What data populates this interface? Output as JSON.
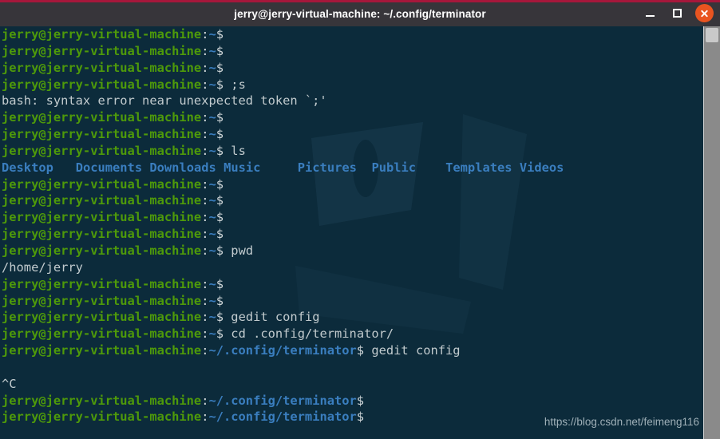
{
  "window": {
    "title": "jerry@jerry-virtual-machine: ~/.config/terminator",
    "controls": {
      "minimize_label": "Minimize",
      "maximize_label": "Maximize",
      "close_label": "Close"
    },
    "accent_color": "#e95420",
    "titlebar_color": "#37353a",
    "stripe_color": "#a6173b"
  },
  "terminal": {
    "background_color": "#0c2b3b",
    "prompt_user_host": "jerry@jerry-virtual-machine",
    "colors": {
      "green": "#4e9a0a",
      "blue": "#3a7ebf",
      "white": "#cfd6d8"
    },
    "lines": [
      {
        "type": "prompt",
        "path": "~",
        "command": ""
      },
      {
        "type": "prompt",
        "path": "~",
        "command": ""
      },
      {
        "type": "prompt",
        "path": "~",
        "command": ""
      },
      {
        "type": "prompt",
        "path": "~",
        "command": " ;s"
      },
      {
        "type": "output",
        "text": "bash: syntax error near unexpected token `;'"
      },
      {
        "type": "prompt",
        "path": "~",
        "command": ""
      },
      {
        "type": "prompt",
        "path": "~",
        "command": ""
      },
      {
        "type": "prompt",
        "path": "~",
        "command": " ls"
      },
      {
        "type": "ls",
        "items": [
          "Desktop",
          "Documents",
          "Downloads",
          "Music",
          "Pictures",
          "Public",
          "Templates",
          "Videos"
        ]
      },
      {
        "type": "prompt",
        "path": "~",
        "command": ""
      },
      {
        "type": "prompt",
        "path": "~",
        "command": ""
      },
      {
        "type": "prompt",
        "path": "~",
        "command": ""
      },
      {
        "type": "prompt",
        "path": "~",
        "command": ""
      },
      {
        "type": "prompt",
        "path": "~",
        "command": " pwd"
      },
      {
        "type": "output",
        "text": "/home/jerry"
      },
      {
        "type": "prompt",
        "path": "~",
        "command": ""
      },
      {
        "type": "prompt",
        "path": "~",
        "command": ""
      },
      {
        "type": "prompt",
        "path": "~",
        "command": " gedit config"
      },
      {
        "type": "prompt",
        "path": "~",
        "command": " cd .config/terminator/"
      },
      {
        "type": "prompt",
        "path": "~/.config/terminator",
        "command": " gedit config"
      },
      {
        "type": "output",
        "text": ""
      },
      {
        "type": "output",
        "text": "^C"
      },
      {
        "type": "prompt",
        "path": "~/.config/terminator",
        "command": ""
      },
      {
        "type": "prompt",
        "path": "~/.config/terminator",
        "command": ""
      }
    ]
  },
  "watermark": {
    "text": "https://blog.csdn.net/feimeng116"
  },
  "scrollbar": {
    "label": "vertical-scrollbar"
  }
}
